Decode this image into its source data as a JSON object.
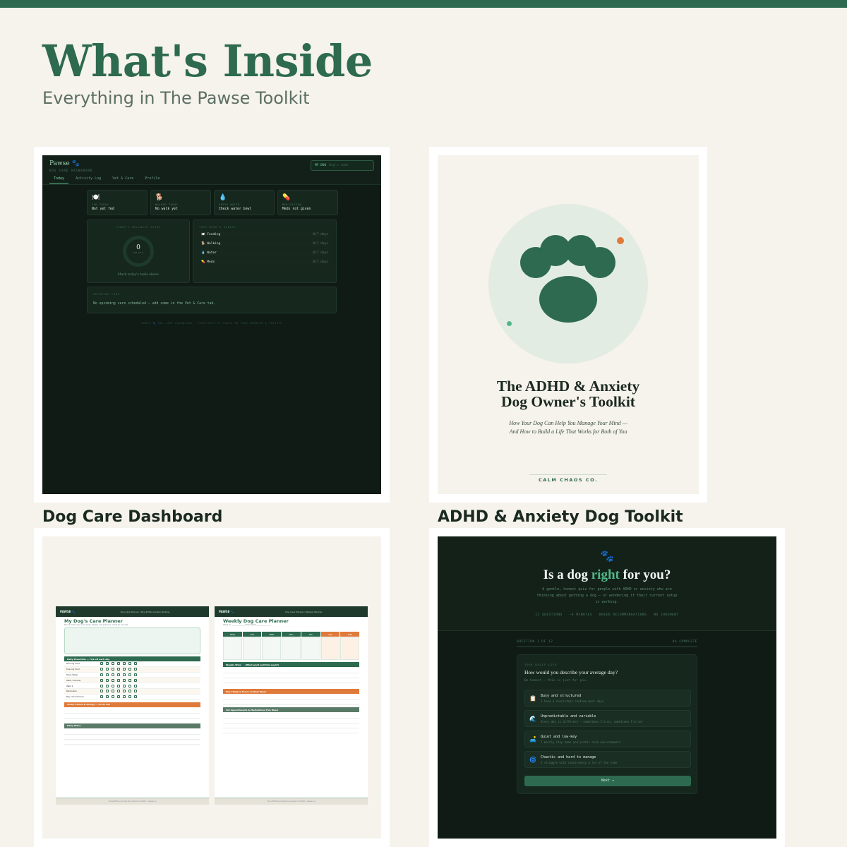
{
  "header": {
    "title": "What's Inside",
    "subtitle": "Everything in The Pawse Toolkit"
  },
  "colors": {
    "brand_green": "#2d6a4f",
    "accent_orange": "#e07a3a",
    "background": "#f6f2ec"
  },
  "cards": [
    {
      "label": "Dog Care Dashboard"
    },
    {
      "label": "ADHD & Anxiety Dog Toolkit"
    },
    {
      "label": ""
    },
    {
      "label": ""
    }
  ],
  "dashboard": {
    "brand": "Pawse 🐾",
    "brand_sub": "DOG CARE DASHBOARD",
    "dog_label": "MY DOG",
    "dog_placeholder": "Dog's name",
    "tabs": [
      "Today",
      "Activity Log",
      "Vet & Care",
      "Profile"
    ],
    "stats": [
      {
        "icon": "🍽️",
        "label": "FED TODAY",
        "value": "Not yet fed"
      },
      {
        "icon": "🐕",
        "label": "WALKED TODAY",
        "value": "No walk yet"
      },
      {
        "icon": "💧",
        "label": "FRESH WATER",
        "value": "Check water bowl"
      },
      {
        "icon": "💊",
        "label": "MEDICATION",
        "value": "Meds not given"
      }
    ],
    "wellness_heading": "TODAY'S WELLNESS SCORE",
    "wellness_score": "0",
    "wellness_of": "OUT OF 4",
    "wellness_hint": "Mark today's tasks above",
    "week_heading": "THIS WEEK'S HABITS",
    "habits": [
      {
        "icon": "🍽️",
        "name": "Feeding",
        "days": "0/7 days"
      },
      {
        "icon": "🐕",
        "name": "Walking",
        "days": "0/7 days"
      },
      {
        "icon": "💧",
        "name": "Water",
        "days": "0/7 days"
      },
      {
        "icon": "💊",
        "name": "Meds",
        "days": "0/7 days"
      }
    ],
    "upcoming_heading": "UPCOMING CARE",
    "upcoming_text": "No upcoming care scheduled — add some in the Vet & Care tab.",
    "footer": "PAWSE 🐾 DOG CARE DASHBOARD · YOUR DATA IS SAVED IN YOUR BROWSER & PRIVATE"
  },
  "cover": {
    "title_line1": "The ADHD & Anxiety",
    "title_line2": "Dog Owner's Toolkit",
    "subtitle_line1": "How Your Dog Can Help You Manage Your Mind —",
    "subtitle_line2": "And How to Build a Life That Works for Both of You",
    "publisher": "CALM CHAOS CO."
  },
  "planner": {
    "page1": {
      "brand": "PAWSE 🐾",
      "nav": "Dog Care Planner  |  Dog Profile & Daily Routine",
      "title": "My Dog's Care Planner",
      "subtitle": "Print a fresh copy each week. Simple, low-pressure, made for real life.",
      "section_daily": "Daily Essentials — Tick off each day",
      "daily_rows": [
        "Morning Food",
        "Evening Food",
        "Fresh Water",
        "Walk / Outside",
        "Walk 2",
        "Medication",
        "Play / Enrichment"
      ],
      "section_mood": "Today's Mood & Energy — Circle one",
      "section_notes": "Daily Notes",
      "footer": "The ADHD & Anxiety Dog Owner's Toolkit · pawse.co"
    },
    "page2": {
      "brand": "PAWSE 🐾",
      "nav": "Dog Care Planner  |  Weekly Planner",
      "title": "Weekly Dog Care Planner",
      "subtitle": "Week of _______________     Dog's Name _______________",
      "days": [
        "MON",
        "TUE",
        "WED",
        "THU",
        "FRI",
        "SAT",
        "SUN"
      ],
      "section_wins": "Weekly Wins 🐾 (What went well this week?)",
      "section_focus": "One Thing to Focus on Next Week",
      "section_vet": "Vet Appointments & Medications This Week",
      "footer": "The ADHD & Anxiety Dog Owner's Toolkit · pawse.co"
    }
  },
  "quiz": {
    "icon": "🐾",
    "title_pre": "Is a dog ",
    "title_em": "right",
    "title_post": " for you?",
    "description": "A gentle, honest quiz for people with ADHD or anxiety who are thinking about getting a dog — or wondering if their current setup is working.",
    "tags": [
      "12 QUESTIONS",
      "~4 MINUTES",
      "BREED RECOMMENDATIONS",
      "NO JUDGMENT"
    ],
    "progress_label": "QUESTION 1 OF 12",
    "progress_complete": "0% COMPLETE",
    "progress_value": 0,
    "category": "YOUR DAILY LIFE",
    "question": "How would you describe your average day?",
    "hint": "Be honest — this is just for you.",
    "options": [
      {
        "icon": "📋",
        "title": "Busy and structured",
        "desc": "I have a consistent routine most days"
      },
      {
        "icon": "🌊",
        "title": "Unpredictable and variable",
        "desc": "Every day is different — sometimes I'm on, sometimes I'm not"
      },
      {
        "icon": "🛋️",
        "title": "Quiet and low-key",
        "desc": "I mostly stay home and prefer calm environments"
      },
      {
        "icon": "🌀",
        "title": "Chaotic and hard to manage",
        "desc": "I struggle with consistency a lot of the time"
      }
    ],
    "next_label": "Next →"
  }
}
